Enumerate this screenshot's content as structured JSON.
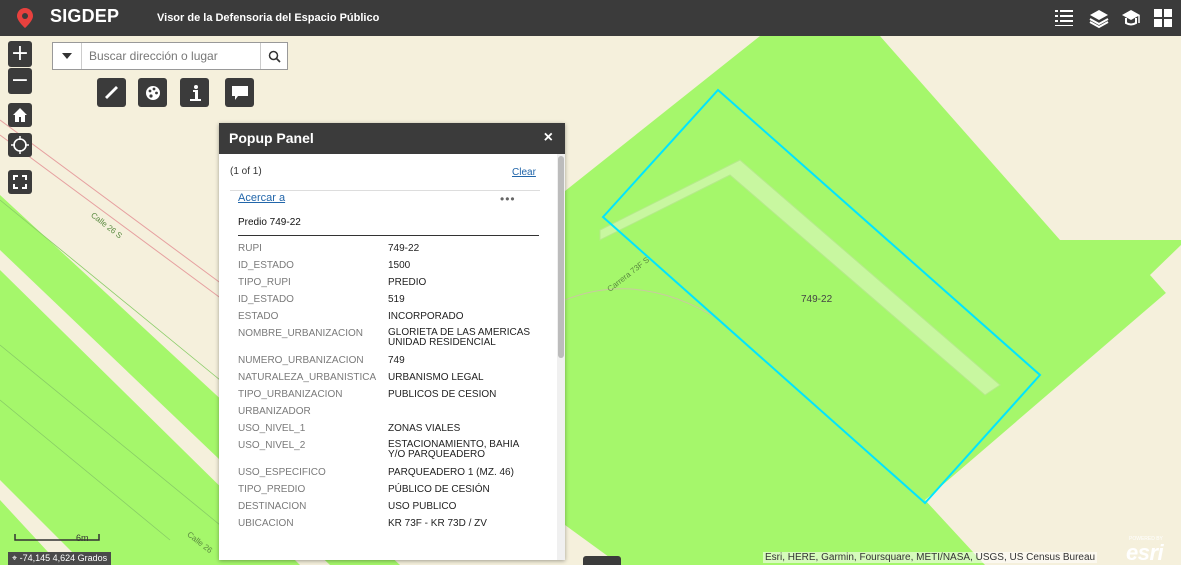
{
  "header": {
    "app_name": "SIGDEP",
    "subtitle": "Visor de la Defensoria del Espacio Público",
    "icons": [
      "list-icon",
      "layers-icon",
      "legend-icon",
      "basemap-icon"
    ]
  },
  "search": {
    "placeholder": "Buscar dirección o lugar"
  },
  "zoom": {
    "in_label": "+",
    "out_label": "−"
  },
  "popup": {
    "title": "Popup Panel",
    "close_label": "×",
    "count_text": "(1 of 1)",
    "clear_label": "Clear",
    "zoom_label": "Acercar a",
    "more_label": "•••",
    "feature_title": "Predio 749-22",
    "attributes": [
      {
        "key": "RUPI",
        "value": "749-22"
      },
      {
        "key": "ID_ESTADO",
        "value": "1500"
      },
      {
        "key": "TIPO_RUPI",
        "value": "PREDIO"
      },
      {
        "key": "ID_ESTADO",
        "value": "519"
      },
      {
        "key": "ESTADO",
        "value": "INCORPORADO"
      },
      {
        "key": "NOMBRE_URBANIZACION",
        "value": "GLORIETA DE LAS AMERICAS",
        "value2": "UNIDAD RESIDENCIAL"
      },
      {
        "key": "NUMERO_URBANIZACION",
        "value": "749"
      },
      {
        "key": "NATURALEZA_URBANISTICA",
        "value": "URBANISMO LEGAL"
      },
      {
        "key": "TIPO_URBANIZACION",
        "value": "PUBLICOS DE CESION"
      },
      {
        "key": "URBANIZADOR",
        "value": ""
      },
      {
        "key": "USO_NIVEL_1",
        "value": "ZONAS VIALES"
      },
      {
        "key": "USO_NIVEL_2",
        "value": "ESTACIONAMIENTO, BAHIA",
        "value2": "Y/O PARQUEADERO"
      },
      {
        "key": "USO_ESPECIFICO",
        "value": "PARQUEADERO 1 (MZ. 46)"
      },
      {
        "key": "TIPO_PREDIO",
        "value": "PÚBLICO DE CESIÓN"
      },
      {
        "key": "DESTINACION",
        "value": "USO PUBLICO"
      },
      {
        "key": "UBICACION",
        "value": "KR 73F - KR 73D / ZV"
      }
    ]
  },
  "map": {
    "parcel_label": "749-22",
    "street_labels": [
      "Calle 26 S",
      "Carrera 73F S",
      "Calle 26"
    ],
    "scale_label": "6m",
    "coordinates": "-74,145 4,624 Grados",
    "attribution": "Esri, HERE, Garmin, Foursquare, METI/NASA, USGS, US Census Bureau",
    "esri_powered": "POWERED BY",
    "esri_logo": "esri",
    "colors": {
      "green": "#a5f76b",
      "road": "#f5f0dc",
      "selection": "#00e5ff",
      "toolbar": "#3b3b3b"
    }
  }
}
